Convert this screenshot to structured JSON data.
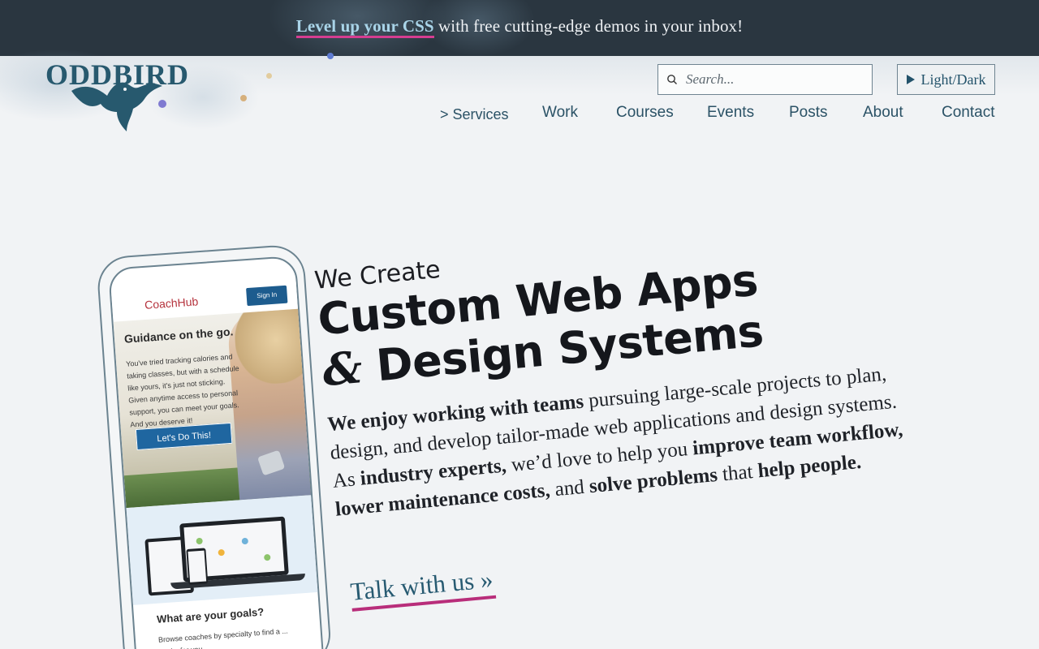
{
  "banner": {
    "link_text": "Level up your CSS",
    "rest_text": " with free cutting-edge demos in your inbox!"
  },
  "logo": {
    "text": "ODDBIRD"
  },
  "search": {
    "placeholder": "Search..."
  },
  "theme_toggle": {
    "label": "Light/Dark"
  },
  "nav": {
    "items": [
      {
        "label": "> Services"
      },
      {
        "label": "Work"
      },
      {
        "label": "Courses"
      },
      {
        "label": "Events"
      },
      {
        "label": "Posts"
      },
      {
        "label": "About"
      },
      {
        "label": "Contact"
      }
    ]
  },
  "hero": {
    "kicker": "We Create",
    "headline_line1": "Custom Web Apps",
    "headline_amp": "&",
    "headline_line2": " Design Systems",
    "body": [
      {
        "text": "We enjoy working with teams",
        "bold": true
      },
      {
        "text": " pursuing large-scale projects to plan, design, and develop tailor-made web applications and design systems. As ",
        "bold": false
      },
      {
        "text": "industry experts,",
        "bold": true
      },
      {
        "text": " we’d love to help you ",
        "bold": false
      },
      {
        "text": "improve team workflow, lower maintenance costs,",
        "bold": true
      },
      {
        "text": " and ",
        "bold": false
      },
      {
        "text": "solve problems",
        "bold": true
      },
      {
        "text": " that ",
        "bold": false
      },
      {
        "text": "help people.",
        "bold": true
      }
    ],
    "cta": "Talk with us »"
  },
  "phone_mockup": {
    "app_name": "CoachHub",
    "signin": "Sign In",
    "title": "Guidance on the go.",
    "paragraph": "You've tried tracking calories and taking classes, but with a schedule like yours, it's just not sticking. Given anytime access to personal support, you can meet your goals. And you deserve it!",
    "cta": "Let's Do This!",
    "title2": "What are your goals?",
    "paragraph2": "Browse coaches by specialty to find a ... works for you."
  },
  "colors": {
    "banner_bg": "#2a3640",
    "banner_link": "#a9d4e8",
    "underline_accent": "#d63d91",
    "brand_teal": "#27596e",
    "page_bg": "#f1f3f5"
  }
}
